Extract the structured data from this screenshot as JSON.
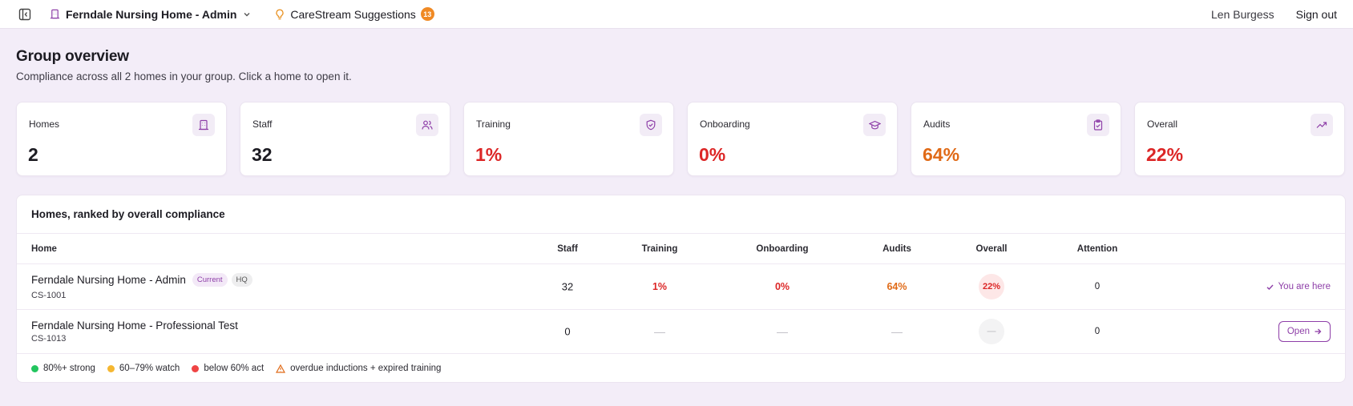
{
  "topbar": {
    "home_switcher": "Ferndale Nursing Home - Admin",
    "suggestions_label": "CareStream Suggestions",
    "suggestions_count": "13",
    "user_name": "Len Burgess",
    "sign_out": "Sign out"
  },
  "heading": {
    "title": "Group overview",
    "subtitle": "Compliance across all 2 homes in your group. Click a home to open it."
  },
  "cards": [
    {
      "label": "Homes",
      "value": "2",
      "icon": "building-icon"
    },
    {
      "label": "Staff",
      "value": "32",
      "icon": "users-icon"
    },
    {
      "label": "Training",
      "value": "1%",
      "icon": "shield-check-icon"
    },
    {
      "label": "Onboarding",
      "value": "0%",
      "icon": "graduation-cap-icon"
    },
    {
      "label": "Audits",
      "value": "64%",
      "icon": "clipboard-check-icon"
    },
    {
      "label": "Overall",
      "value": "22%",
      "icon": "trending-up-icon"
    }
  ],
  "table": {
    "title": "Homes, ranked by overall compliance",
    "headers": {
      "home": "Home",
      "staff": "Staff",
      "training": "Training",
      "onboarding": "Onboarding",
      "audits": "Audits",
      "overall": "Overall",
      "attention": "Attention"
    },
    "rows": [
      {
        "name": "Ferndale Nursing Home - Admin",
        "code": "CS-1001",
        "tag_current": "Current",
        "tag_hq": "HQ",
        "staff": "32",
        "training": "1%",
        "onboarding": "0%",
        "audits": "64%",
        "overall": "22%",
        "attention": "0",
        "action": "You are here"
      },
      {
        "name": "Ferndale Nursing Home - Professional Test",
        "code": "CS-1013",
        "staff": "0",
        "training": "—",
        "onboarding": "—",
        "audits": "—",
        "overall": "—",
        "attention": "0",
        "action": "Open"
      }
    ],
    "legend": {
      "strong": "80%+ strong",
      "watch": "60–79% watch",
      "act": "below 60% act",
      "overdue": "overdue inductions + expired training"
    }
  },
  "colors": {
    "accent": "#8e3fa8",
    "red": "#dc2626",
    "orange": "#e06a17",
    "green": "#22c55e",
    "amber": "#f5b731",
    "legend_red": "#ef4444",
    "badge": "#f08a24"
  }
}
